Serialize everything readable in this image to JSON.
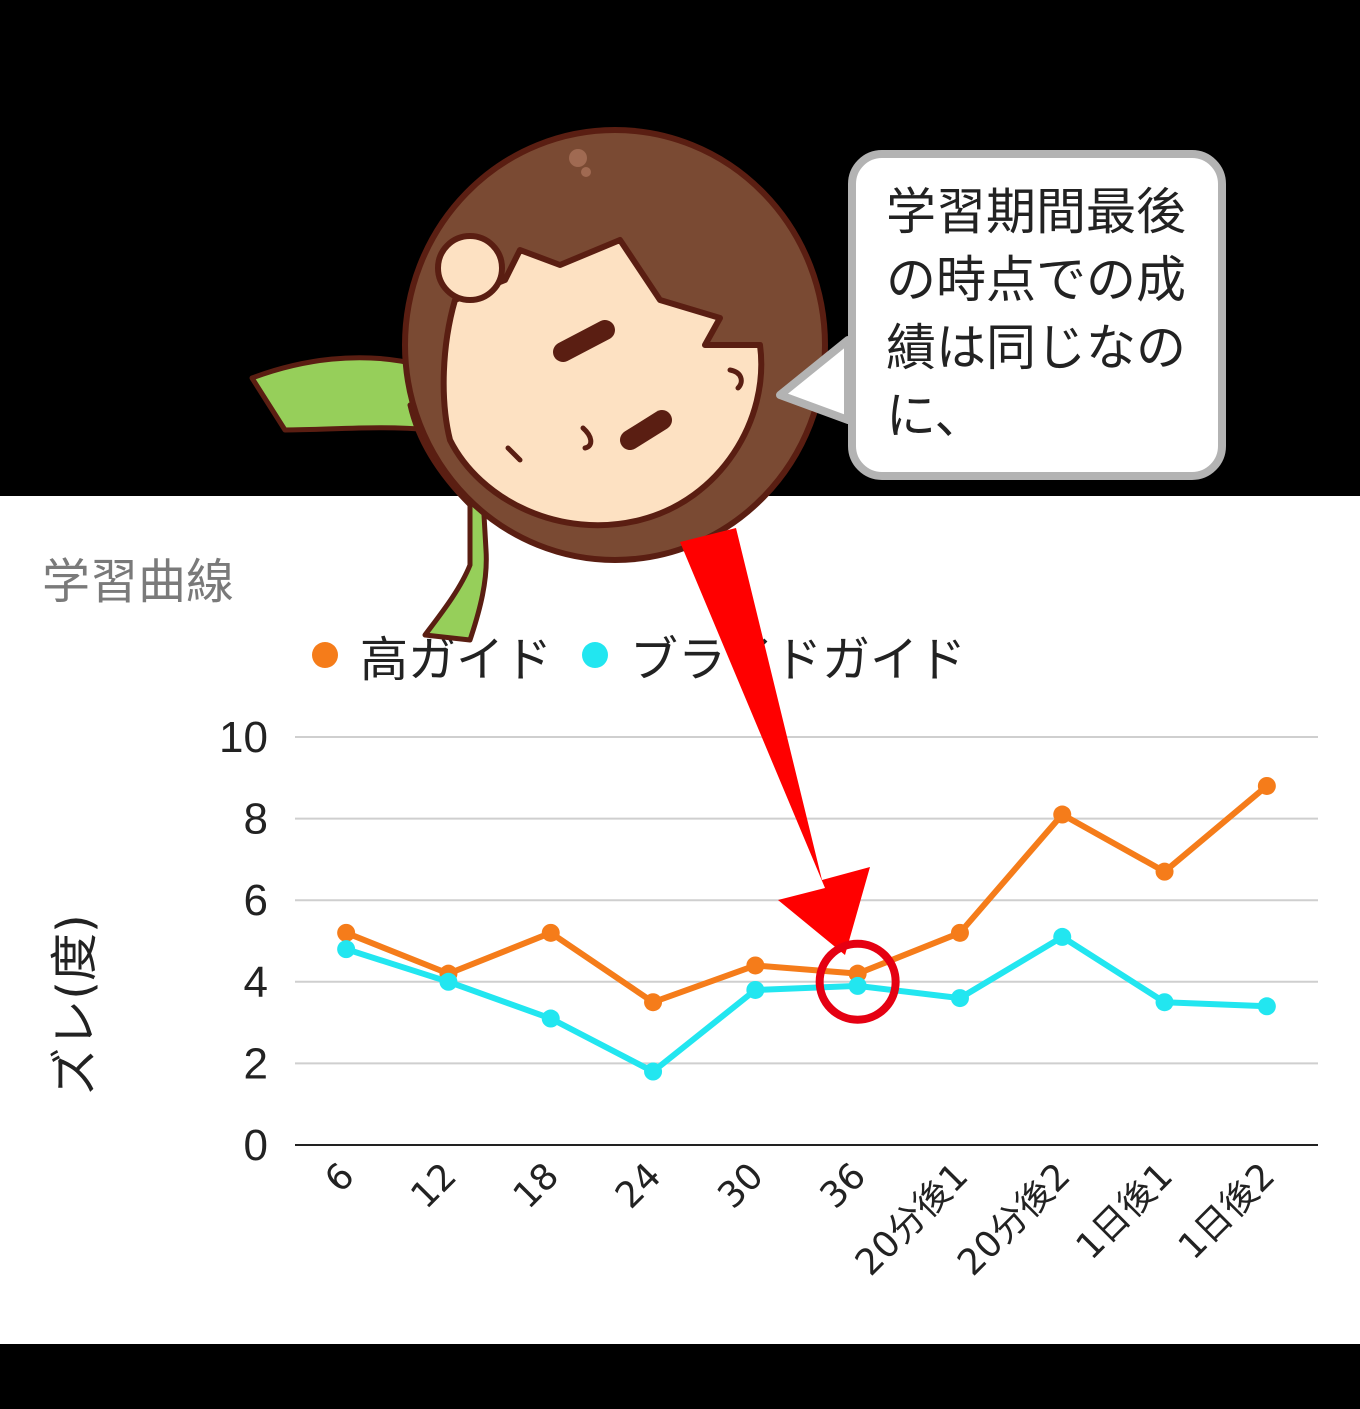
{
  "speech_bubble": {
    "text": "学習期間最後の時点での成績は同じなのに、"
  },
  "chart_data": {
    "type": "line",
    "title": "学習曲線",
    "ylabel": "ズレ(度)",
    "xlabel": "",
    "ylim": [
      0,
      10
    ],
    "yticks": [
      "0",
      "2",
      "4",
      "6",
      "8",
      "10"
    ],
    "categories": [
      "6",
      "12",
      "18",
      "24",
      "30",
      "36",
      "20分後1",
      "20分後2",
      "1日後1",
      "1日後2"
    ],
    "series": [
      {
        "name": "高ガイド",
        "color": "#f57c1a",
        "values": [
          5.2,
          4.2,
          5.2,
          3.5,
          4.4,
          4.2,
          5.2,
          8.1,
          6.7,
          8.8
        ]
      },
      {
        "name": "ブライドガイド",
        "color": "#22e6f0",
        "values": [
          4.8,
          4.0,
          3.1,
          1.8,
          3.8,
          3.9,
          3.6,
          5.1,
          3.5,
          3.4
        ]
      }
    ],
    "legend_position": "top",
    "grid": true
  },
  "annotation": {
    "arrow_color": "#ff0000",
    "circle_color": "#e50012",
    "highlight_category": "36"
  },
  "colors": {
    "hair": "#7a4a33",
    "skin": "#fde1c2",
    "scarf": "#96cf5a",
    "outline": "#5a1e12"
  }
}
